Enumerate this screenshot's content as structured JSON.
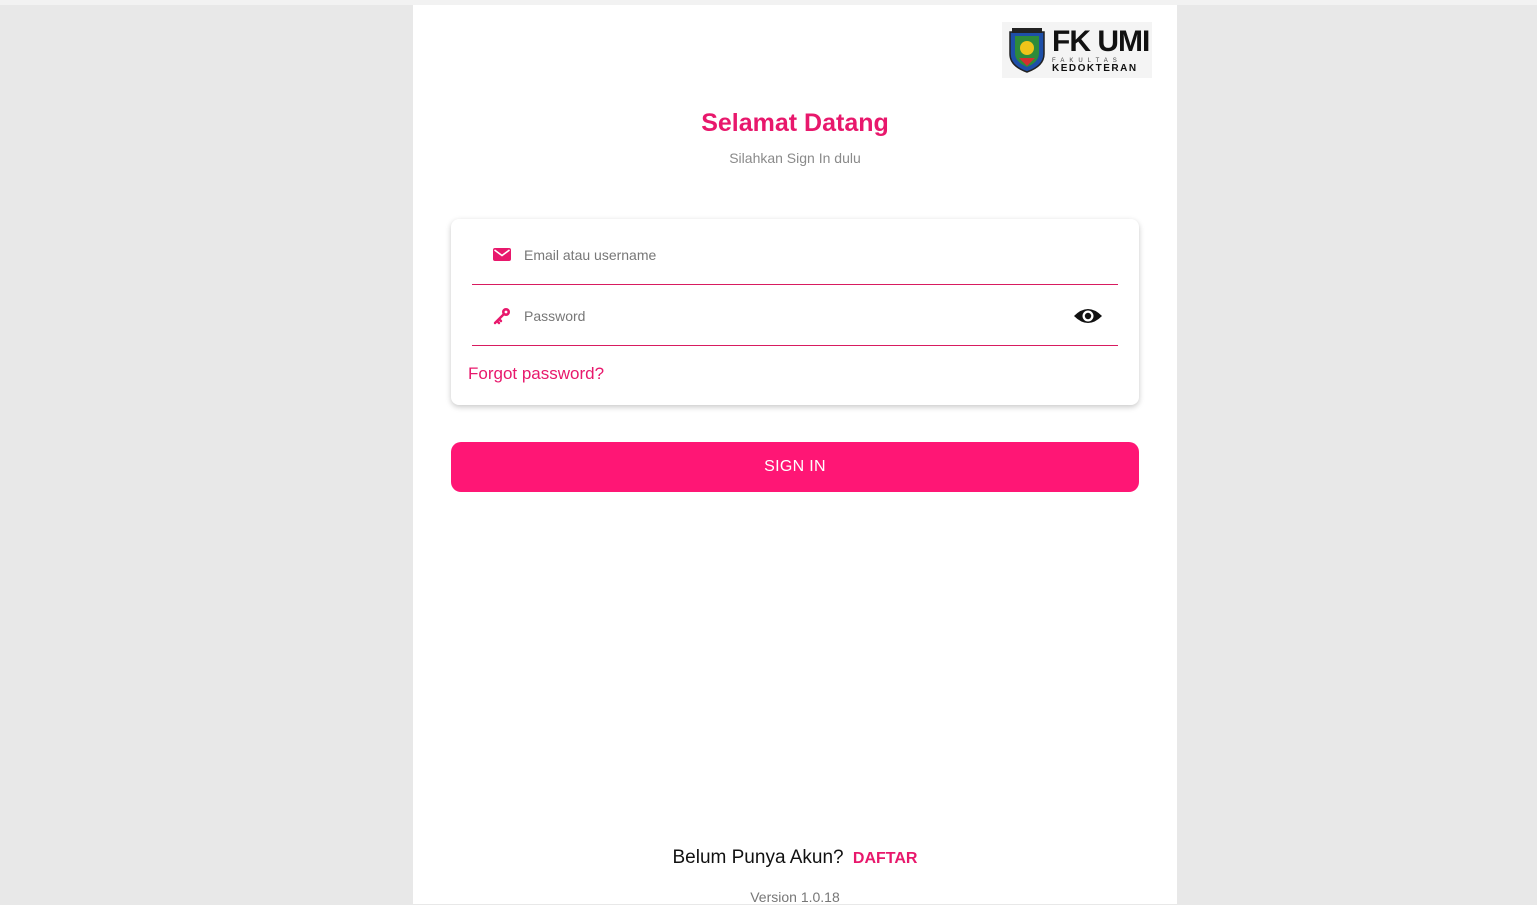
{
  "logo": {
    "main": "FK UMI",
    "sub_top": "FAKULTAS",
    "sub": "KEDOKTERAN"
  },
  "header": {
    "title": "Selamat Datang",
    "subtitle": "Silahkan Sign In dulu"
  },
  "form": {
    "email_placeholder": "Email atau username",
    "email_value": "",
    "email_icon": "envelope-icon",
    "password_placeholder": "Password",
    "password_value": "",
    "password_icon": "key-icon",
    "toggle_icon": "eye-icon",
    "forgot_label": "Forgot password?"
  },
  "actions": {
    "signin_label": "SIGN IN"
  },
  "footer": {
    "register_prompt": "Belum Punya Akun?",
    "register_link": "DAFTAR",
    "version": "Version 1.0.18"
  },
  "colors": {
    "accent": "#e8186c",
    "button": "#ff1675",
    "background": "#e8e8e8"
  }
}
